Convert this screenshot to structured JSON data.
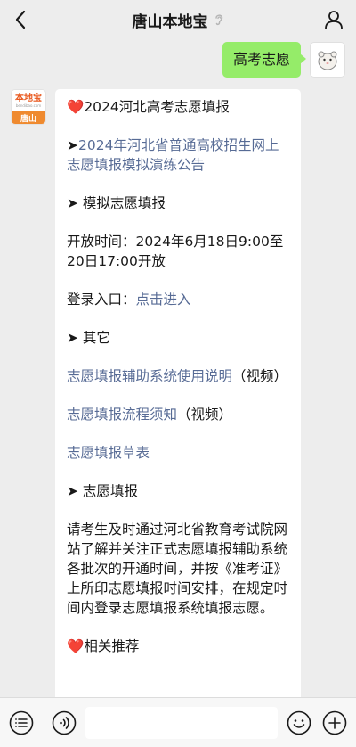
{
  "header": {
    "title": "唐山本地宝"
  },
  "outgoing_message": {
    "text": "高考志愿"
  },
  "bot": {
    "avatar_logo": "本地宝",
    "avatar_sub": "bendibao.com",
    "avatar_city": "唐山"
  },
  "incoming_message": {
    "heading_1": "2024河北高考志愿填报",
    "notice_prefix": "➤",
    "notice_link": "2024年河北省普通高校招生网上志愿填报模拟演练公告",
    "section_mock": "➤ 模拟志愿填报",
    "open_time": "开放时间：2024年6月18日9:00至20日17:00开放",
    "login_label": "登录入口：",
    "login_link": "点击进入",
    "section_other": "➤ 其它",
    "other_link_1": "志愿填报辅助系统使用说明",
    "other_link_1_suffix": "（视频）",
    "other_link_2": "志愿填报流程须知",
    "other_link_2_suffix": "（视频）",
    "other_link_3": "志愿填报草表",
    "section_fill": "➤ 志愿填报",
    "fill_body": "请考生及时通过河北省教育考试院网站了解并关注正式志愿填报辅助系统各批次的开通时间，并按《准考证》上所印志愿填报时间安排，在规定时间内登录志愿填报系统填报志愿。",
    "heading_2": "相关推荐"
  },
  "input": {
    "value": ""
  },
  "colors": {
    "outgoing_bubble": "#95ec69",
    "link": "#576b95",
    "heart": "#e0152b"
  }
}
